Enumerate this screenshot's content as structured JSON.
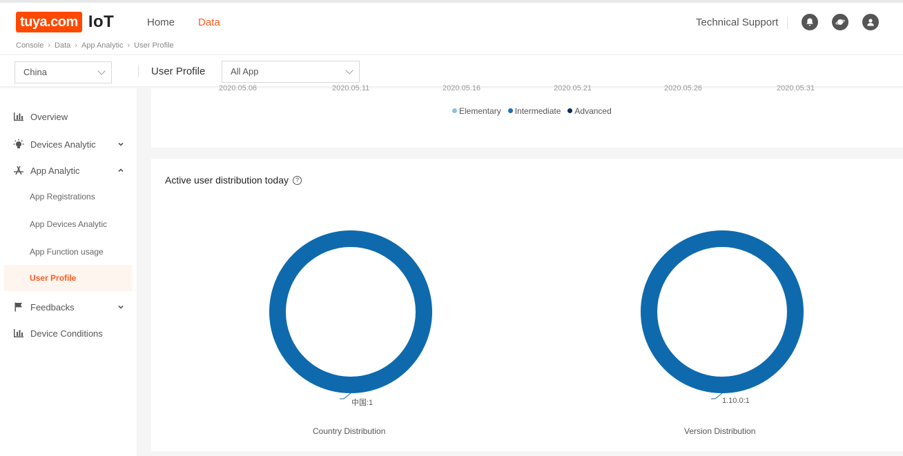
{
  "header": {
    "logo_text": "tuya.com",
    "logo_suffix": "IoT",
    "nav": [
      {
        "label": "Home",
        "active": false
      },
      {
        "label": "Data",
        "active": true
      }
    ],
    "tech_support": "Technical Support"
  },
  "breadcrumb": [
    "Console",
    "Data",
    "App Analytic",
    "User Profile"
  ],
  "filters": {
    "region": "China",
    "page_label": "User Profile",
    "app": "All App"
  },
  "sidebar": {
    "items": [
      {
        "label": "Overview"
      },
      {
        "label": "Devices Analytic"
      },
      {
        "label": "App Analytic"
      },
      {
        "label": "Feedbacks"
      },
      {
        "label": "Device Conditions"
      }
    ],
    "sub_items": [
      {
        "label": "App Registrations"
      },
      {
        "label": "App Devices Analytic"
      },
      {
        "label": "App Function usage"
      },
      {
        "label": "User Profile"
      }
    ]
  },
  "top_chart": {
    "dates": [
      "2020.05.06",
      "2020.05.11",
      "2020.05.16",
      "2020.05.21",
      "2020.05.26",
      "2020.05.31"
    ],
    "legend": [
      {
        "label": "Elementary",
        "color": "#8cc1e0"
      },
      {
        "label": "Intermediate",
        "color": "#1f6fb2"
      },
      {
        "label": "Advanced",
        "color": "#0b2f5e"
      }
    ]
  },
  "active_users": {
    "title": "Active user distribution today",
    "help": "?"
  },
  "chart_data": [
    {
      "type": "pie",
      "title": "Country Distribution",
      "categories": [
        "中国"
      ],
      "values": [
        1
      ],
      "labels": [
        "中国:1"
      ],
      "color": "#0e6aad"
    },
    {
      "type": "pie",
      "title": "Version Distribution",
      "categories": [
        "1.10.0"
      ],
      "values": [
        1
      ],
      "labels": [
        "1.10.0:1"
      ],
      "color": "#0e6aad"
    }
  ]
}
